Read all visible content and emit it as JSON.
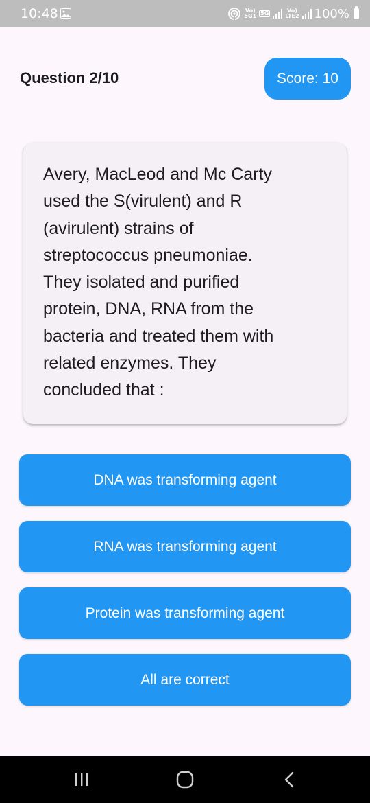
{
  "status_bar": {
    "time": "10:48",
    "net_left_top": "Vo)",
    "net_left_bottom": "5G1",
    "five_g": "5G",
    "net_right_top": "Vo)",
    "net_right_bottom": "LTE2",
    "battery": "100%",
    "icons": [
      "gallery-icon",
      "hotspot-icon",
      "signal-icon",
      "battery-icon"
    ]
  },
  "header": {
    "question_counter": "Question 2/10",
    "score": "Score: 10"
  },
  "question": {
    "lines": [
      "Avery, MacLeod and Mc Carty",
      "used the S(virulent) and R",
      "(avirulent) strains of",
      "streptococcus pneumoniae.",
      "They isolated and purified",
      "protein, DNA, RNA from the",
      "bacteria and treated them with",
      "related enzymes. They",
      "concluded that :"
    ]
  },
  "options": [
    {
      "label": "DNA was transforming agent"
    },
    {
      "label": "RNA was transforming agent"
    },
    {
      "label": "Protein was transforming agent"
    },
    {
      "label": "All are correct"
    }
  ],
  "colors": {
    "accent": "#2196f3",
    "background": "#fdf7fd",
    "card": "#f4f0f6",
    "status_bar": "#bdbdbd",
    "nav_bar": "#000000"
  },
  "nav_bar": {
    "icons": [
      "recents-icon",
      "home-icon",
      "back-icon"
    ]
  }
}
